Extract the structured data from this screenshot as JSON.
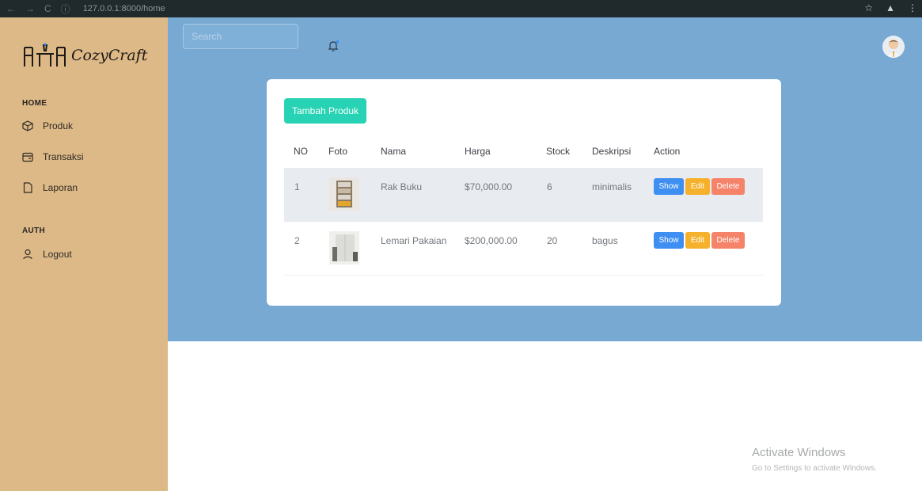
{
  "browser": {
    "url": "127.0.0.1:8000/home",
    "back": "←",
    "forward": "→",
    "reload": "C",
    "info": "ⓘ"
  },
  "sidebar": {
    "brand": "CozyCraft",
    "home_label": "HOME",
    "auth_label": "AUTH",
    "items": [
      {
        "label": "Produk",
        "icon": "box-icon"
      },
      {
        "label": "Transaksi",
        "icon": "wallet-icon"
      },
      {
        "label": "Laporan",
        "icon": "file-icon"
      }
    ],
    "logout": {
      "label": "Logout",
      "icon": "user-icon"
    }
  },
  "header": {
    "search_placeholder": "Search"
  },
  "card": {
    "add_button": "Tambah Produk",
    "columns": [
      "NO",
      "Foto",
      "Nama",
      "Harga",
      "Stock",
      "Deskripsi",
      "Action"
    ],
    "rows": [
      {
        "no": "1",
        "foto": "bookshelf-photo",
        "nama": "Rak Buku",
        "harga": "$70,000.00",
        "stock": "6",
        "deskripsi": "minimalis"
      },
      {
        "no": "2",
        "foto": "wardrobe-photo",
        "nama": "Lemari Pakaian",
        "harga": "$200,000.00",
        "stock": "20",
        "deskripsi": "bagus"
      }
    ],
    "actions": {
      "show": "Show",
      "edit": "Edit",
      "delete": "Delete"
    }
  },
  "watermark": {
    "title": "Activate Windows",
    "subtitle": "Go to Settings to activate Windows."
  },
  "colors": {
    "sidebar": "#ddb987",
    "main": "#78a9d3",
    "primary": "#27d3b4",
    "show": "#3f8ff2",
    "edit": "#f5b12c",
    "delete": "#f5836a"
  }
}
